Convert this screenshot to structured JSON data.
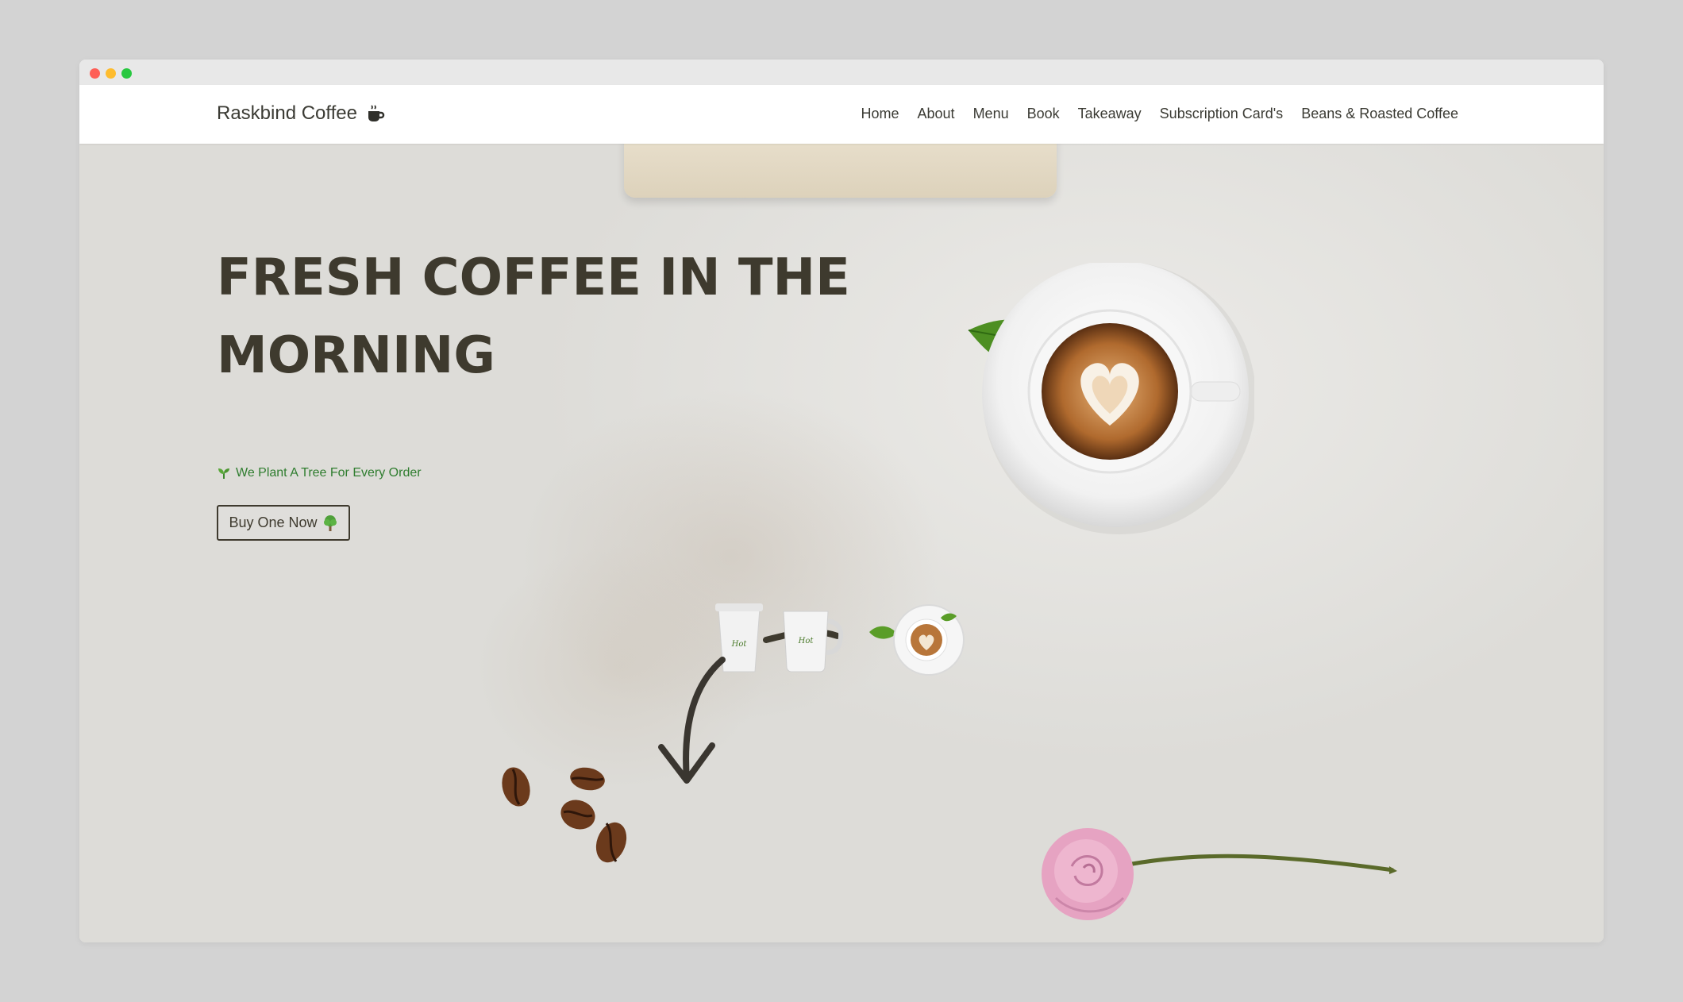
{
  "brand": {
    "name": "Raskbind Coffee",
    "icon": "coffee-cup-icon"
  },
  "nav": {
    "items": [
      "Home",
      "About",
      "Menu",
      "Book",
      "Takeaway",
      "Subscription Card's",
      "Beans & Roasted Coffee"
    ]
  },
  "hero": {
    "headline": "FRESH COFFEE IN THE MORNING",
    "tagline": "We Plant A Tree For Every Order",
    "tagline_icon": "seedling-icon",
    "button_label": "Buy One Now",
    "button_icon": "tree-icon"
  },
  "colors": {
    "text_dark": "#3e3a2e",
    "accent_green": "#2f7d2f",
    "background": "#dedcd8"
  }
}
